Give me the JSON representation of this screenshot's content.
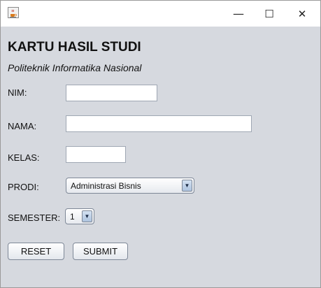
{
  "window": {
    "controls": {
      "minimize": "—",
      "maximize": "☐",
      "close": "✕"
    }
  },
  "header": {
    "title": "KARTU HASIL STUDI",
    "subtitle": "Politeknik Informatika Nasional"
  },
  "form": {
    "nim": {
      "label": "NIM:",
      "value": ""
    },
    "nama": {
      "label": "NAMA:",
      "value": ""
    },
    "kelas": {
      "label": "KELAS:",
      "value": ""
    },
    "prodi": {
      "label": "PRODI:",
      "selected": "Administrasi Bisnis"
    },
    "semester": {
      "label": "SEMESTER:",
      "selected": "1"
    }
  },
  "buttons": {
    "reset": "RESET",
    "submit": "SUBMIT"
  },
  "icons": {
    "dropdown": "▼"
  },
  "colors": {
    "background": "#d6d9df",
    "titlebar": "#ffffff"
  }
}
